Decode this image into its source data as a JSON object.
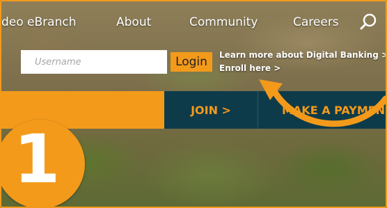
{
  "nav": {
    "items": [
      "deo eBranch",
      "About",
      "Community",
      "Careers"
    ],
    "search_icon": "search-icon"
  },
  "login": {
    "username_placeholder": "Username",
    "login_label": "Login",
    "learn_more": "Learn more about Digital Banking >",
    "enroll": "Enroll here >"
  },
  "actions": {
    "join": "JOIN >",
    "payment": "MAKE A PAYMEN"
  },
  "annotation": {
    "step_number": "1",
    "arrow_icon": "curved-arrow-icon"
  },
  "colors": {
    "accent": "#f39a1b",
    "navy": "#0e3b4a"
  }
}
